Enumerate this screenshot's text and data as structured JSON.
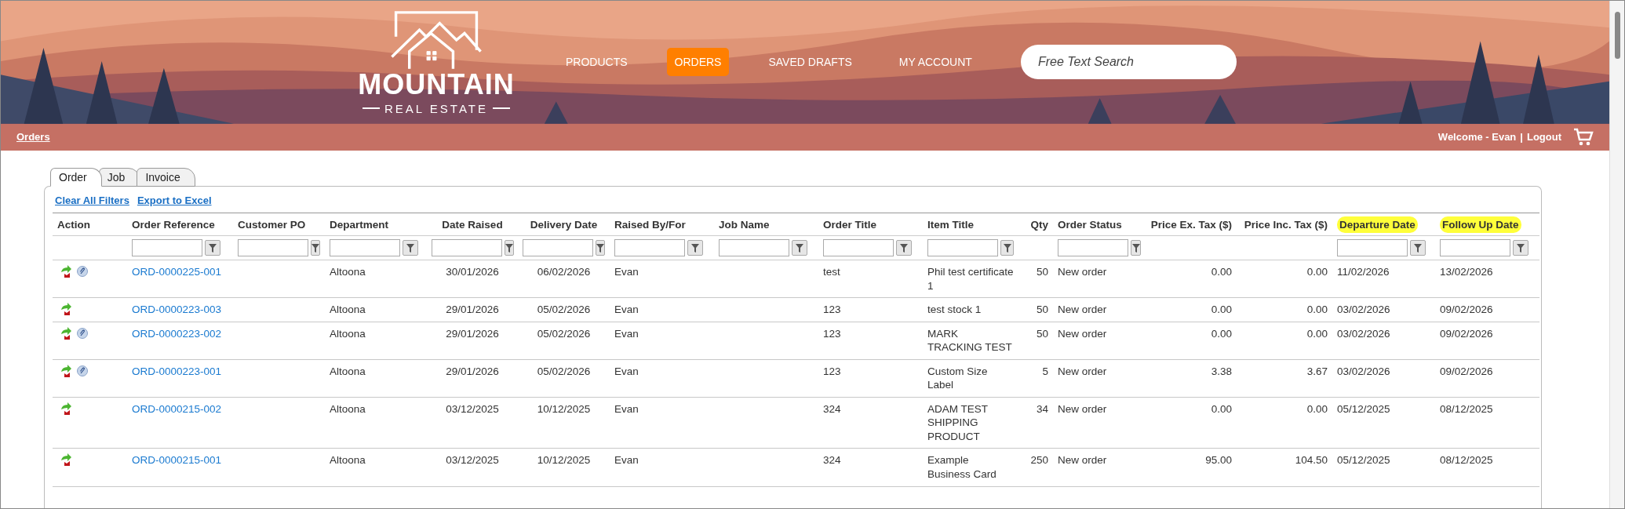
{
  "header": {
    "logo": {
      "name": "MOUNTAIN",
      "tagline": "REAL ESTATE"
    },
    "nav": [
      {
        "label": "PRODUCTS",
        "selected": false
      },
      {
        "label": "ORDERS",
        "selected": true
      },
      {
        "label": "SAVED DRAFTS",
        "selected": false
      },
      {
        "label": "MY ACCOUNT",
        "selected": false
      }
    ],
    "search": {
      "placeholder": "Free Text Search"
    }
  },
  "breadcrumb_bar": {
    "breadcrumb": "Orders",
    "welcome": "Welcome - Evan",
    "separator": "|",
    "logout": "Logout"
  },
  "tabs": [
    {
      "label": "Order",
      "selected": true
    },
    {
      "label": "Job",
      "selected": false
    },
    {
      "label": "Invoice",
      "selected": false
    }
  ],
  "toolbar_links": [
    "Clear All Filters",
    "Export to Excel"
  ],
  "table": {
    "columns": [
      {
        "label": "Action",
        "filter": false,
        "highlighted": false
      },
      {
        "label": "Order Reference",
        "filter": true,
        "highlighted": false
      },
      {
        "label": "Customer PO",
        "filter": true,
        "highlighted": false
      },
      {
        "label": "Department",
        "filter": true,
        "highlighted": false
      },
      {
        "label": "Date Raised",
        "filter": true,
        "highlighted": false
      },
      {
        "label": "Delivery Date",
        "filter": true,
        "highlighted": false
      },
      {
        "label": "Raised By/For",
        "filter": true,
        "highlighted": false
      },
      {
        "label": "Job Name",
        "filter": true,
        "highlighted": false
      },
      {
        "label": "Order Title",
        "filter": true,
        "highlighted": false
      },
      {
        "label": "Item Title",
        "filter": true,
        "highlighted": false
      },
      {
        "label": "Qty",
        "filter": false,
        "highlighted": false
      },
      {
        "label": "Order Status",
        "filter": true,
        "highlighted": false
      },
      {
        "label": "Price Ex. Tax ($)",
        "filter": false,
        "highlighted": false
      },
      {
        "label": "Price Inc. Tax ($)",
        "filter": false,
        "highlighted": false
      },
      {
        "label": "Departure Date",
        "filter": true,
        "highlighted": true
      },
      {
        "label": "Follow Up Date",
        "filter": true,
        "highlighted": true
      }
    ],
    "rows": [
      {
        "attachment": true,
        "cells": [
          "",
          "ORD-0000225-001",
          "",
          "Altoona",
          "30/01/2026",
          "06/02/2026",
          "Evan",
          "",
          "test",
          "Phil test certificate 1",
          "50",
          "New order",
          "0.00",
          "0.00",
          "11/02/2026",
          "13/02/2026"
        ]
      },
      {
        "attachment": false,
        "cells": [
          "",
          "ORD-0000223-003",
          "",
          "Altoona",
          "29/01/2026",
          "05/02/2026",
          "Evan",
          "",
          "123",
          "test stock 1",
          "50",
          "New order",
          "0.00",
          "0.00",
          "03/02/2026",
          "09/02/2026"
        ]
      },
      {
        "attachment": true,
        "cells": [
          "",
          "ORD-0000223-002",
          "",
          "Altoona",
          "29/01/2026",
          "05/02/2026",
          "Evan",
          "",
          "123",
          "MARK TRACKING TEST",
          "50",
          "New order",
          "0.00",
          "0.00",
          "03/02/2026",
          "09/02/2026"
        ]
      },
      {
        "attachment": true,
        "cells": [
          "",
          "ORD-0000223-001",
          "",
          "Altoona",
          "29/01/2026",
          "05/02/2026",
          "Evan",
          "",
          "123",
          "Custom Size Label",
          "5",
          "New order",
          "3.38",
          "3.67",
          "03/02/2026",
          "09/02/2026"
        ]
      },
      {
        "attachment": false,
        "cells": [
          "",
          "ORD-0000215-002",
          "",
          "Altoona",
          "03/12/2025",
          "10/12/2025",
          "Evan",
          "",
          "324",
          "ADAM TEST SHIPPING PRODUCT",
          "34",
          "New order",
          "0.00",
          "0.00",
          "05/12/2025",
          "08/12/2025"
        ]
      },
      {
        "attachment": false,
        "cells": [
          "",
          "ORD-0000215-001",
          "",
          "Altoona",
          "03/12/2025",
          "10/12/2025",
          "Evan",
          "",
          "324",
          "Example Business Card",
          "250",
          "New order",
          "95.00",
          "104.50",
          "05/12/2025",
          "08/12/2025"
        ]
      }
    ]
  }
}
